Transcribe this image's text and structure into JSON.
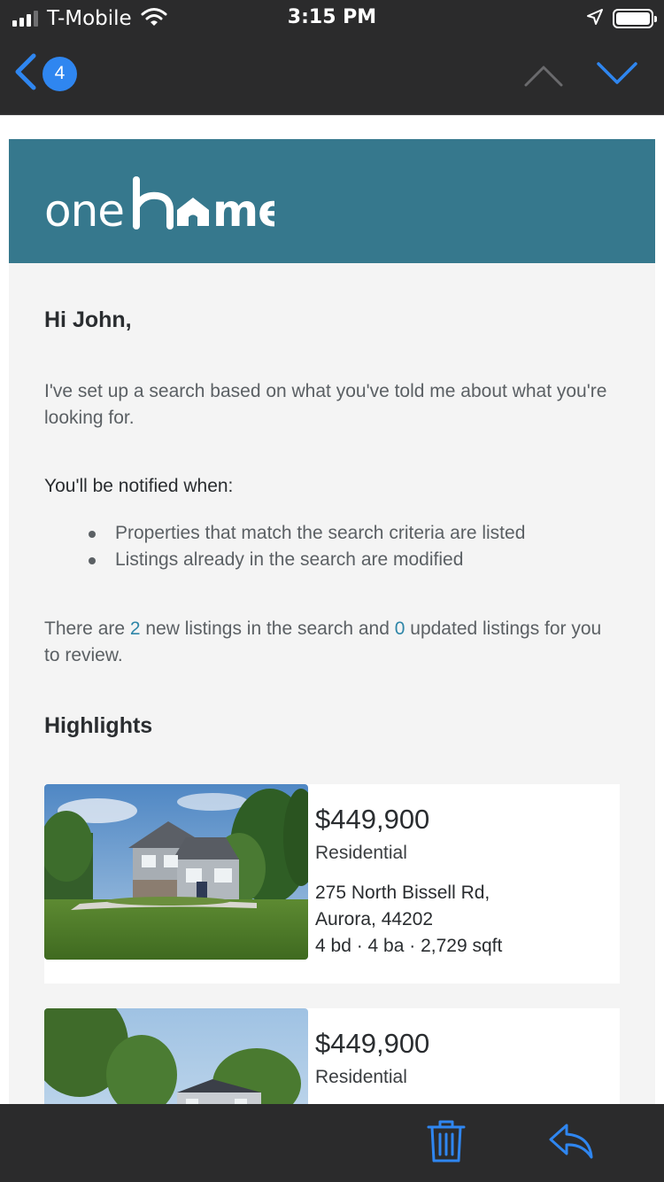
{
  "status_bar": {
    "carrier": "T-Mobile",
    "time": "3:15 PM"
  },
  "nav": {
    "unread_count": "4"
  },
  "brand": {
    "logo_text": "onehome",
    "header_color": "#36788d"
  },
  "email": {
    "greeting": "Hi John,",
    "intro": "I've set up a search based on what you've told me about what you're looking for.",
    "notify_title": "You'll be notified when:",
    "bullets": [
      "Properties that match the search criteria are listed",
      "Listings already in the search are modified"
    ],
    "summary": {
      "prefix": "There are ",
      "new_count": "2",
      "middle": " new listings in the search and ",
      "updated_count": "0",
      "suffix": " updated listings for you to review."
    },
    "highlights_title": "Highlights",
    "listings": [
      {
        "price": "$449,900",
        "type": "Residential",
        "address_line1": "275 North Bissell Rd,",
        "address_line2": "Aurora, 44202",
        "specs": "4 bd · 4 ba · 2,729 sqft"
      },
      {
        "price": "$449,900",
        "type": "Residential"
      }
    ]
  },
  "icons": {
    "back": "chevron-left-icon",
    "previous": "chevron-up-icon",
    "next": "chevron-down-icon",
    "trash": "trash-icon",
    "reply": "reply-icon"
  },
  "colors": {
    "accent": "#2f86f0",
    "link": "#2f86a8",
    "chrome": "#2b2b2c"
  }
}
